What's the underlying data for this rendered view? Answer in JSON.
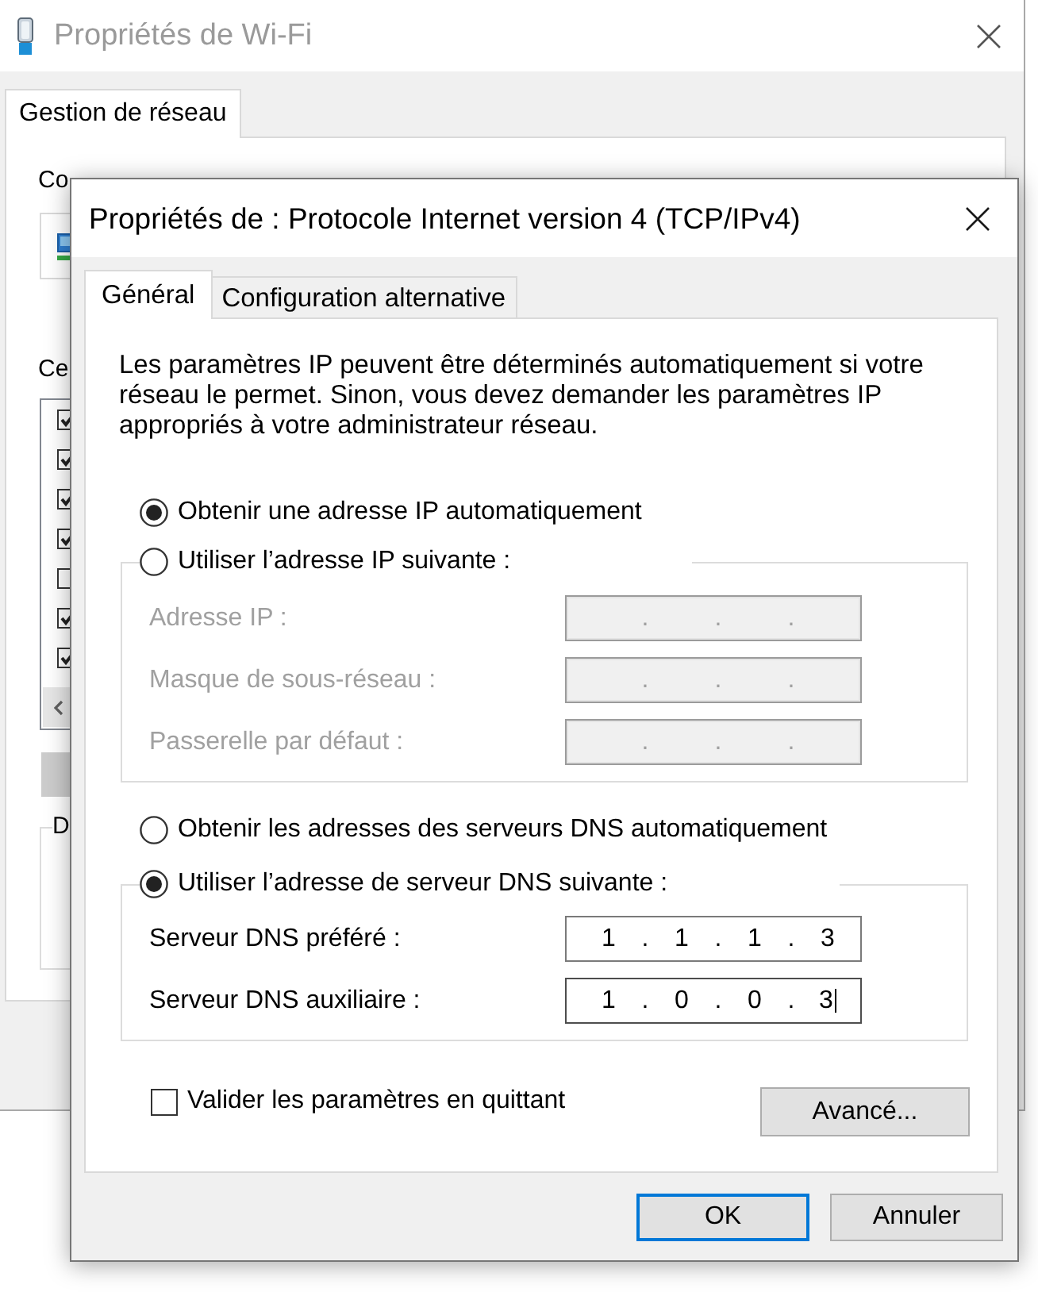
{
  "background_window": {
    "title": "Propriétés de Wi-Fi",
    "active": false,
    "tabs": [
      {
        "label": "Gestion de réseau",
        "selected": true
      }
    ],
    "connection_label": "Co",
    "components_label": "Ce",
    "components": [
      {
        "checked": true
      },
      {
        "checked": true
      },
      {
        "checked": true
      },
      {
        "checked": true
      },
      {
        "checked": false
      },
      {
        "checked": true
      },
      {
        "checked": true
      }
    ],
    "description_label": "D"
  },
  "dialog": {
    "title": "Propriétés de : Protocole Internet version 4 (TCP/IPv4)",
    "active": true,
    "tabs": [
      {
        "label": "Général",
        "selected": true
      },
      {
        "label": "Configuration alternative",
        "selected": false
      }
    ],
    "intro": "Les paramètres IP peuvent être déterminés automatiquement si votre réseau le permet. Sinon, vous devez demander les paramètres IP appropriés à votre administrateur réseau.",
    "ip_mode": [
      {
        "label": "Obtenir une adresse IP automatiquement",
        "selected": true
      },
      {
        "label": "Utiliser l’adresse IP suivante :",
        "selected": false
      }
    ],
    "ip_fields": [
      {
        "label": "Adresse IP :",
        "value": ". . .",
        "disabled": true,
        "focused": false
      },
      {
        "label": "Masque de sous-réseau :",
        "value": ". . .",
        "disabled": true,
        "focused": false
      },
      {
        "label": "Passerelle par défaut :",
        "value": ". . .",
        "disabled": true,
        "focused": false
      }
    ],
    "dns_mode": [
      {
        "label": "Obtenir les adresses des serveurs DNS automatiquement",
        "selected": false
      },
      {
        "label": "Utiliser l’adresse de serveur DNS suivante :",
        "selected": true
      }
    ],
    "dns_fields": [
      {
        "label": "Serveur DNS préféré :",
        "value": "1 . 1 . 1 . 3",
        "disabled": false,
        "focused": false
      },
      {
        "label": "Serveur DNS auxiliaire :",
        "value": "1 . 0 . 0 . 3",
        "disabled": false,
        "focused": true
      }
    ],
    "validate_on_exit": {
      "label": "Valider les paramètres en quittant",
      "checked": false
    },
    "advanced_button": "Avancé...",
    "buttons": [
      {
        "label": "OK",
        "default": true
      },
      {
        "label": "Annuler",
        "default": false
      }
    ]
  }
}
